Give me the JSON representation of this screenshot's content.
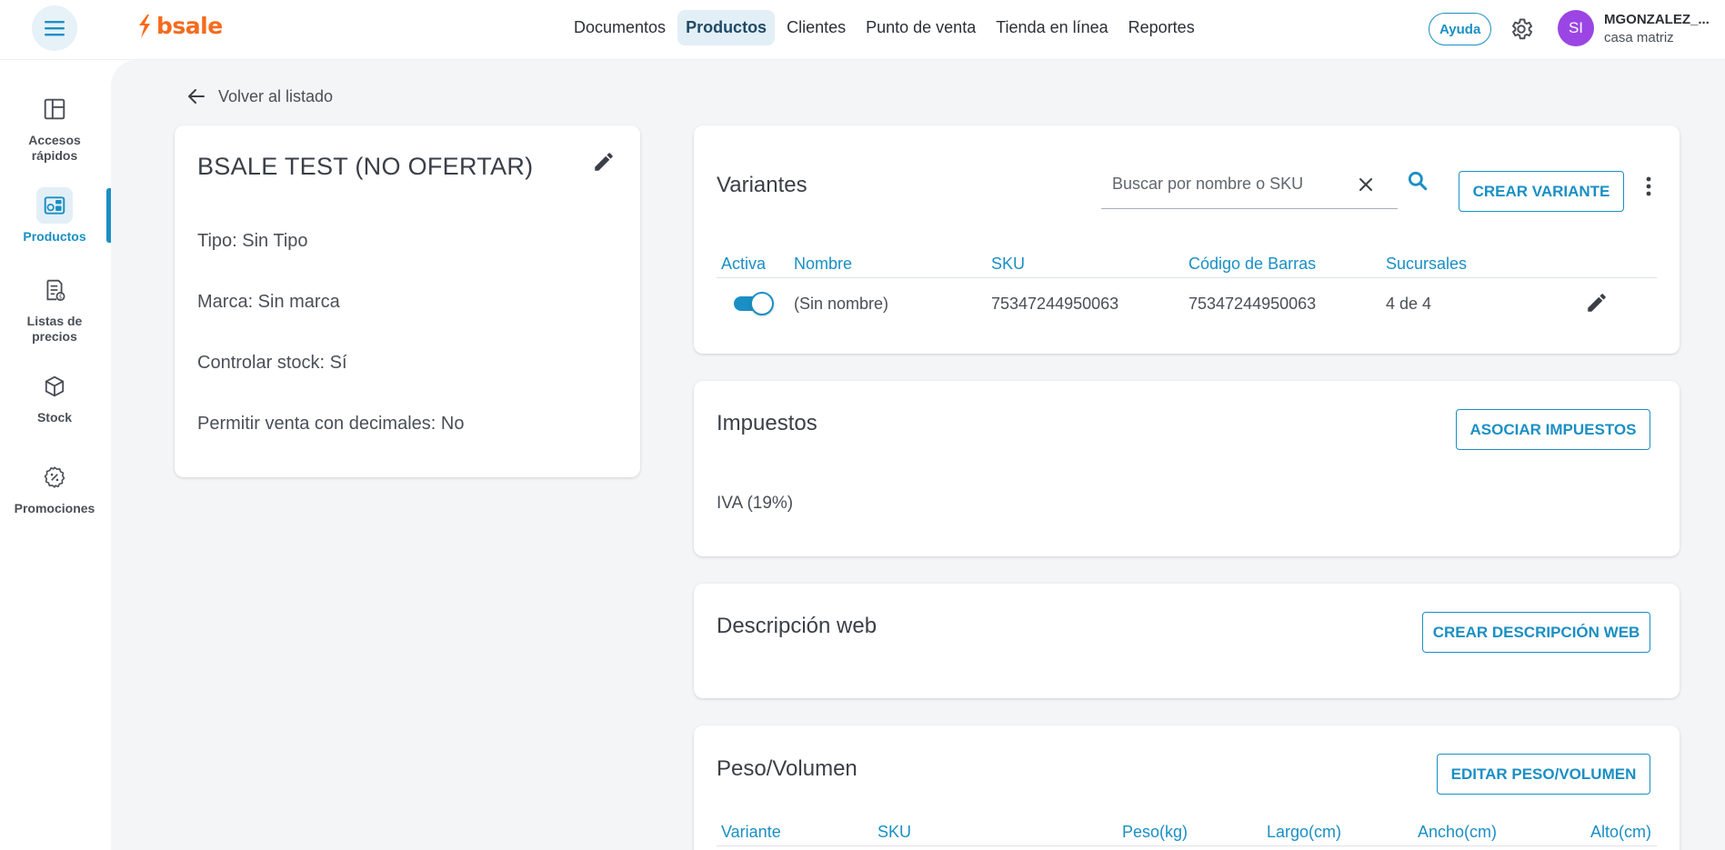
{
  "topbar": {
    "logo_text": "bsale",
    "nav": [
      {
        "label": "Documentos"
      },
      {
        "label": "Productos",
        "active": true
      },
      {
        "label": "Clientes"
      },
      {
        "label": "Punto de venta"
      },
      {
        "label": "Tienda en línea"
      },
      {
        "label": "Reportes"
      }
    ],
    "help_label": "Ayuda",
    "user": {
      "initials": "SI",
      "name": "MGONZALEZ_...",
      "branch": "casa matriz"
    }
  },
  "sidebar": {
    "items": [
      {
        "label": "Accesos rápidos",
        "icon": "dashboard-icon"
      },
      {
        "label": "Productos",
        "icon": "products-icon",
        "active": true
      },
      {
        "label": "Listas de precios",
        "icon": "price-list-icon"
      },
      {
        "label": "Stock",
        "icon": "box-icon"
      },
      {
        "label": "Promociones",
        "icon": "discount-icon"
      }
    ]
  },
  "back_link": {
    "label": "Volver al listado"
  },
  "product": {
    "title": "BSALE TEST (NO OFERTAR)",
    "attributes": [
      "Tipo: Sin Tipo",
      "Marca: Sin marca",
      "Controlar stock: Sí",
      "Permitir venta con decimales: No"
    ]
  },
  "variants": {
    "title": "Variantes",
    "search_placeholder": "Buscar por nombre o SKU",
    "create_label": "CREAR VARIANTE",
    "columns": [
      "Activa",
      "Nombre",
      "SKU",
      "Código de Barras",
      "Sucursales"
    ],
    "rows": [
      {
        "active": true,
        "name": "(Sin nombre)",
        "sku": "75347244950063",
        "barcode": "75347244950063",
        "branches": "4 de 4"
      }
    ]
  },
  "taxes": {
    "title": "Impuestos",
    "button_label": "ASOCIAR IMPUESTOS",
    "value": "IVA (19%)"
  },
  "web_description": {
    "title": "Descripción web",
    "button_label": "CREAR DESCRIPCIÓN WEB"
  },
  "weight_volume": {
    "title": "Peso/Volumen",
    "button_label": "EDITAR PESO/VOLUMEN",
    "columns": [
      "Variante",
      "SKU",
      "Peso(kg)",
      "Largo(cm)",
      "Ancho(cm)",
      "Alto(cm)"
    ]
  },
  "colors": {
    "accent": "#1a8fc4",
    "brand": "#f56b1f",
    "avatar": "#9b45e4"
  }
}
